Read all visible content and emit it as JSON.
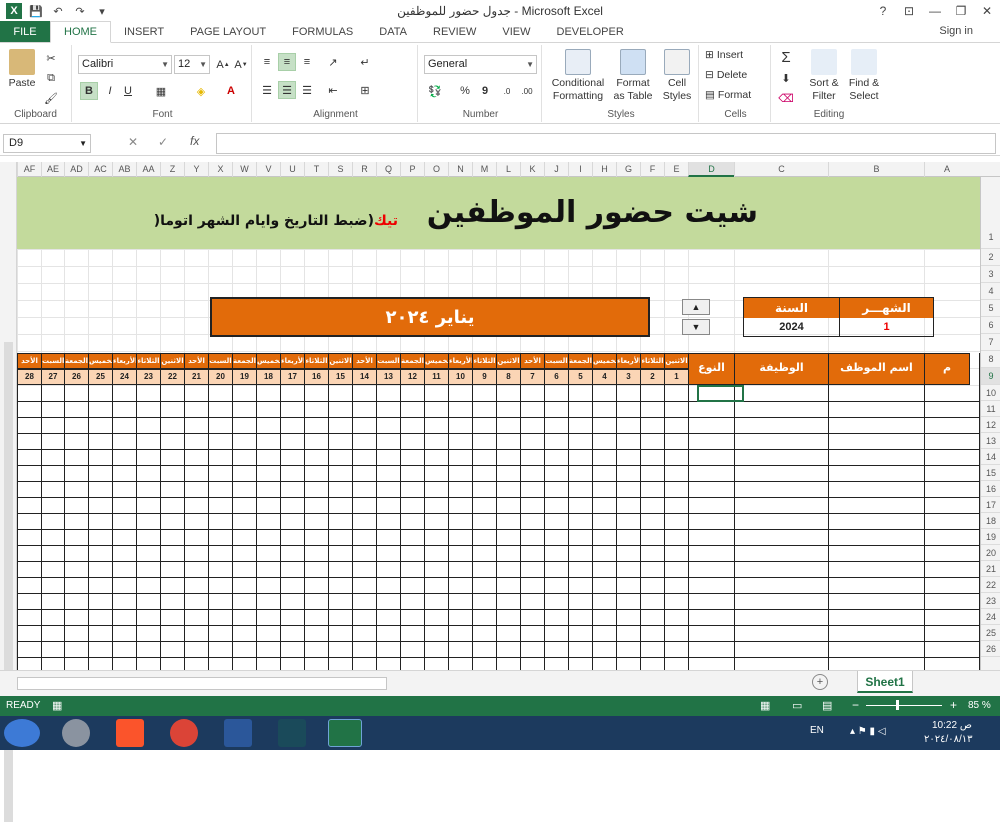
{
  "window": {
    "title": "جدول حضور للموظفين - Microsoft Excel",
    "help": "?",
    "controls": [
      "⊡",
      "—",
      "❐",
      "✕"
    ]
  },
  "ribbon_tabs": {
    "file": "FILE",
    "tabs": [
      "HOME",
      "INSERT",
      "PAGE LAYOUT",
      "FORMULAS",
      "DATA",
      "REVIEW",
      "VIEW",
      "DEVELOPER"
    ],
    "active": "HOME",
    "sign_in": "Sign in"
  },
  "ribbon": {
    "clipboard": {
      "paste": "Paste",
      "label": "Clipboard"
    },
    "font": {
      "name": "Calibri",
      "size": "12",
      "bold": "B",
      "italic": "I",
      "underline": "U",
      "label": "Font"
    },
    "alignment": {
      "label": "Alignment"
    },
    "number": {
      "format": "General",
      "percent": "%",
      "comma": "9",
      "label": "Number"
    },
    "styles": {
      "conditional": "Conditional Formatting",
      "format_table": "Format as Table",
      "cell_styles": "Cell Styles",
      "label": "Styles"
    },
    "cells": {
      "insert": "Insert",
      "delete": "Delete",
      "format": "Format",
      "label": "Cells"
    },
    "editing": {
      "sort": "Sort & Filter",
      "find": "Find & Select",
      "label": "Editing"
    }
  },
  "formula_bar": {
    "name_box": "D9",
    "fx": "fx",
    "value": ""
  },
  "column_headers": [
    "AF",
    "AE",
    "AD",
    "AC",
    "AB",
    "AA",
    "Z",
    "Y",
    "X",
    "W",
    "V",
    "U",
    "T",
    "S",
    "R",
    "Q",
    "P",
    "O",
    "N",
    "M",
    "L",
    "K",
    "J",
    "I",
    "H",
    "G",
    "F",
    "E",
    "D",
    "C",
    "B",
    "A"
  ],
  "selected_column": "D",
  "row_headers": [
    "1",
    "2",
    "3",
    "4",
    "5",
    "6",
    "7",
    "8",
    "9",
    "10",
    "11",
    "12",
    "13",
    "14",
    "15",
    "16",
    "17",
    "18",
    "19",
    "20",
    "21",
    "22",
    "23",
    "24",
    "25",
    "26"
  ],
  "selected_row": "9",
  "sheet": {
    "main_title": "شيت حضور الموظفين",
    "subtitle_prefix": "(ضبط التاريخ وايام الشهر اتوما",
    "subtitle_red": "تيك",
    "subtitle_suffix": ")",
    "month_banner": "يناير ٢٠٢٤",
    "year_label": "السنة",
    "year_value": "2024",
    "month_label": "الشهـــر",
    "month_value": "1",
    "spin_up": "▲",
    "spin_down": "▼",
    "headers": {
      "num": "م",
      "name": "اسم الموظف",
      "job": "الوظيفة",
      "type": "النوع"
    },
    "days": [
      {
        "d": "الاثنين",
        "n": "1"
      },
      {
        "d": "الثلاثاء",
        "n": "2"
      },
      {
        "d": "الأربعاء",
        "n": "3"
      },
      {
        "d": "الخميس",
        "n": "4"
      },
      {
        "d": "الجمعة",
        "n": "5"
      },
      {
        "d": "السبت",
        "n": "6"
      },
      {
        "d": "الأحد",
        "n": "7"
      },
      {
        "d": "الاثنين",
        "n": "8"
      },
      {
        "d": "الثلاثاء",
        "n": "9"
      },
      {
        "d": "الأربعاء",
        "n": "10"
      },
      {
        "d": "الخميس",
        "n": "11"
      },
      {
        "d": "الجمعة",
        "n": "12"
      },
      {
        "d": "السبت",
        "n": "13"
      },
      {
        "d": "الأحد",
        "n": "14"
      },
      {
        "d": "الاثنين",
        "n": "15"
      },
      {
        "d": "الثلاثاء",
        "n": "16"
      },
      {
        "d": "الأربعاء",
        "n": "17"
      },
      {
        "d": "الخميس",
        "n": "18"
      },
      {
        "d": "الجمعة",
        "n": "19"
      },
      {
        "d": "السبت",
        "n": "20"
      },
      {
        "d": "الأحد",
        "n": "21"
      },
      {
        "d": "الاثنين",
        "n": "22"
      },
      {
        "d": "الثلاثاء",
        "n": "23"
      },
      {
        "d": "الأربعاء",
        "n": "24"
      },
      {
        "d": "الخميس",
        "n": "25"
      },
      {
        "d": "الجمعة",
        "n": "26"
      },
      {
        "d": "السبت",
        "n": "27"
      },
      {
        "d": "الأحد",
        "n": "28"
      }
    ]
  },
  "sheet_tabs": {
    "active": "Sheet1",
    "add": "+"
  },
  "status": {
    "ready": "READY",
    "zoom": "85 %"
  },
  "taskbar": {
    "lang": "EN",
    "time": "10:22 ص",
    "date": "٢٠٢٤/٠٨/١٣"
  },
  "colors": {
    "excel_green": "#217346",
    "orange": "#e26b0a",
    "peach": "#fbd5b5",
    "title_green": "#c3da9c"
  }
}
